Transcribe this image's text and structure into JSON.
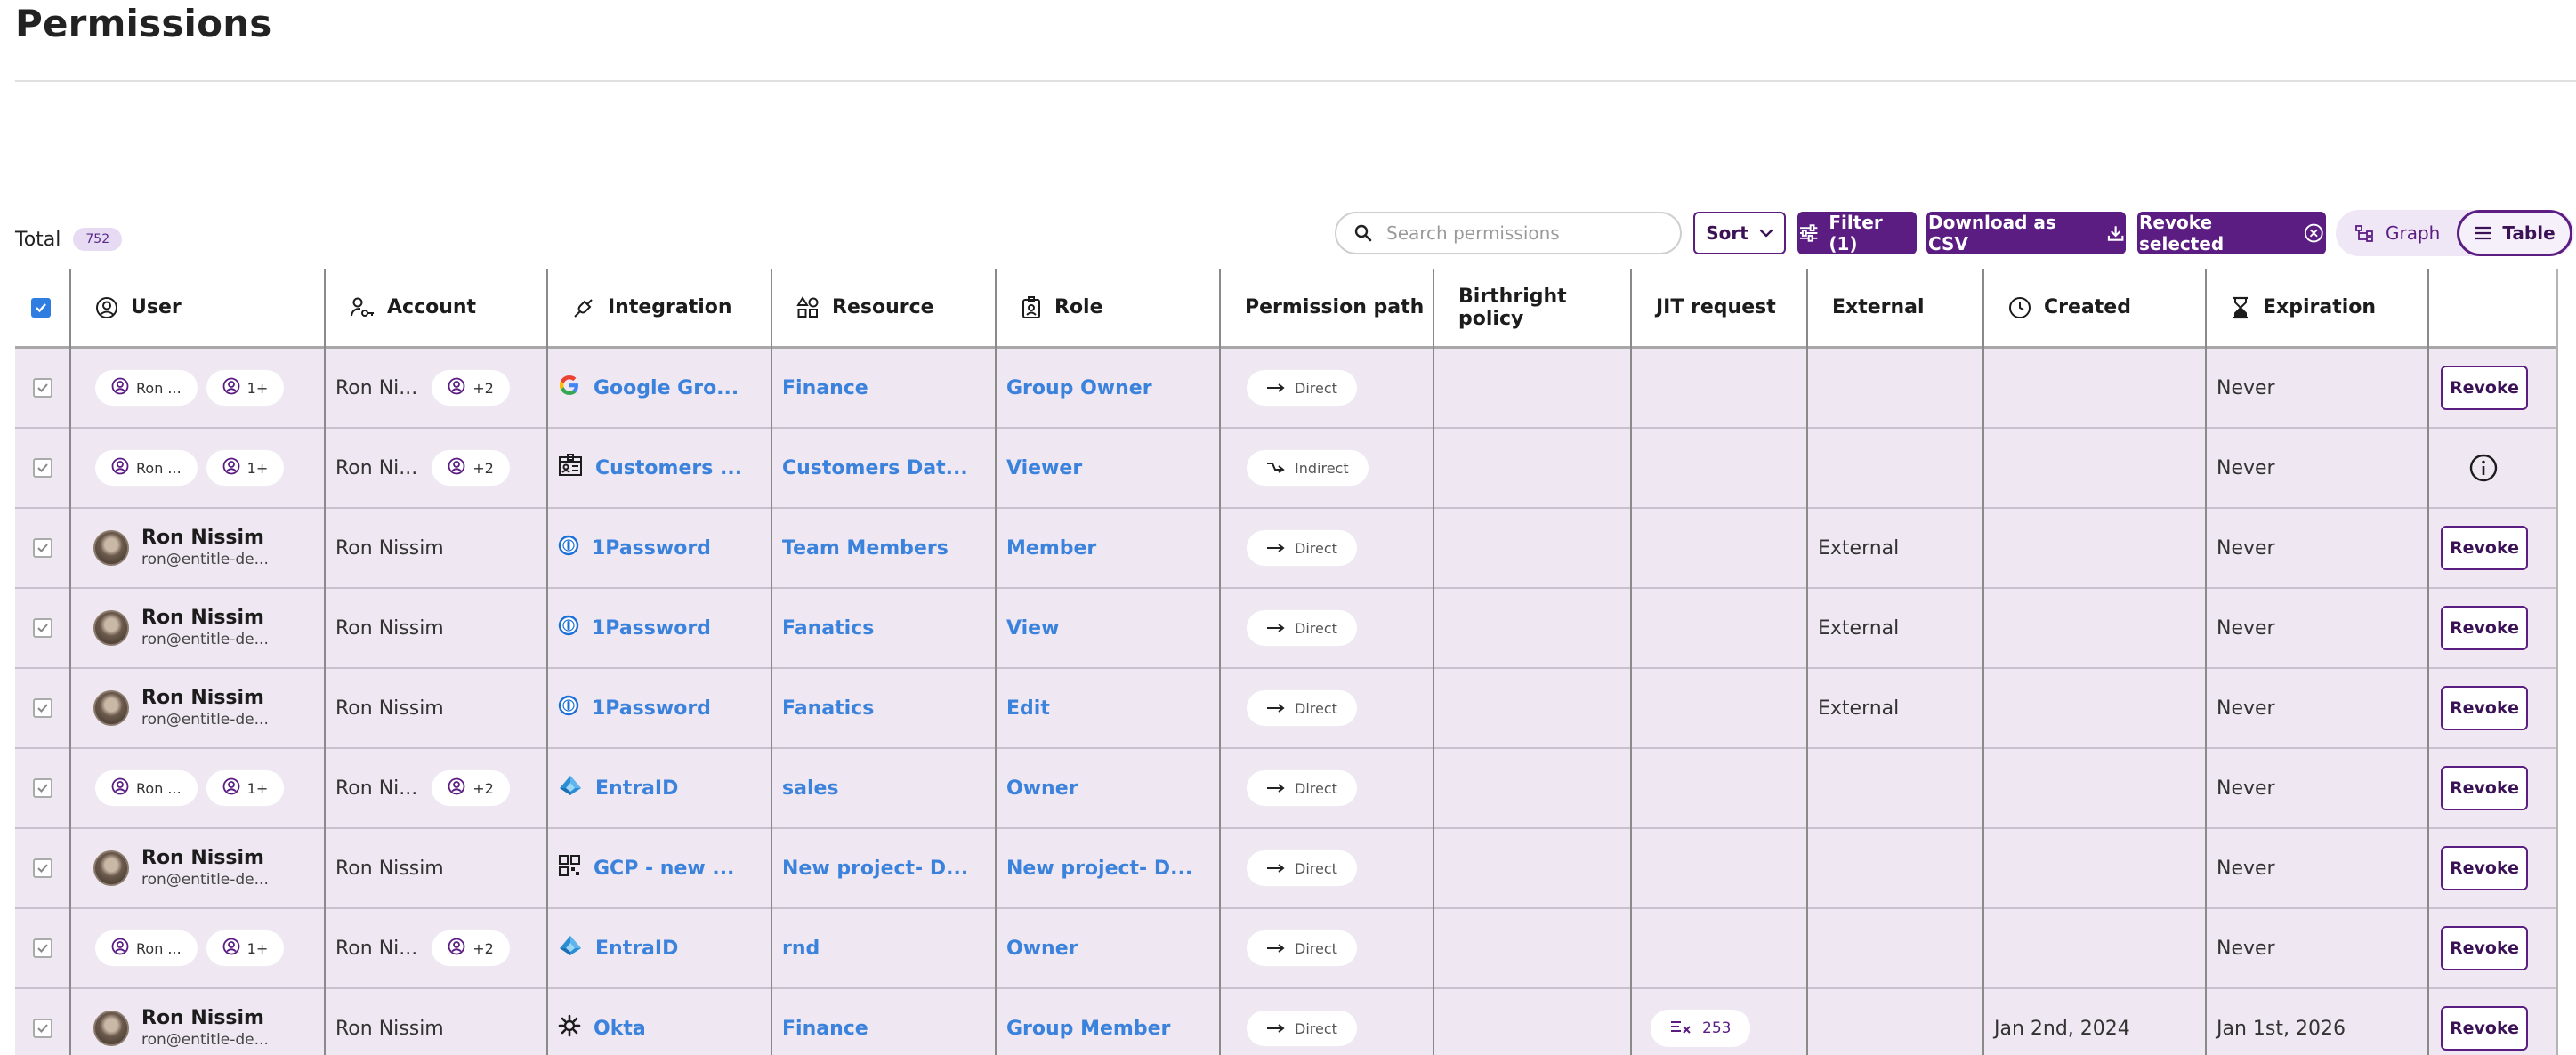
{
  "page": {
    "title": "Permissions"
  },
  "toolbar": {
    "total_label": "Total",
    "total_count": "752",
    "search_placeholder": "Search permissions",
    "sort_label": "Sort",
    "filter_label": "Filter (1)",
    "download_label": "Download as CSV",
    "revoke_selected_label": "Revoke selected",
    "view_graph_label": "Graph",
    "view_table_label": "Table",
    "active_view": "Table"
  },
  "columns": {
    "user": "User",
    "account": "Account",
    "integration": "Integration",
    "resource": "Resource",
    "role": "Role",
    "permission_path": "Permission path",
    "birthright_policy": "Birthright policy",
    "jit_request": "JIT request",
    "external": "External",
    "created": "Created",
    "expiration": "Expiration"
  },
  "rows": [
    {
      "selected": true,
      "user_type": "group",
      "user_chip": "Ron ...",
      "user_extra": "1+",
      "account": "Ron Ni...",
      "account_extra": "+2",
      "integration_icon": "google-icon",
      "integration": "Google Gro...",
      "resource": "Finance",
      "role": "Group Owner",
      "path": "Direct",
      "birthright": "",
      "jit": "",
      "external": "",
      "created": "",
      "expiration": "Never",
      "action": "revoke",
      "action_label": "Revoke"
    },
    {
      "selected": true,
      "user_type": "group",
      "user_chip": "Ron ...",
      "user_extra": "1+",
      "account": "Ron Ni...",
      "account_extra": "+2",
      "integration_icon": "customers-db-icon",
      "integration": "Customers ...",
      "resource": "Customers Dat...",
      "role": "Viewer",
      "path": "Indirect",
      "birthright": "",
      "jit": "",
      "external": "",
      "created": "",
      "expiration": "Never",
      "action": "info",
      "action_label": ""
    },
    {
      "selected": true,
      "user_type": "person",
      "user_name": "Ron Nissim",
      "user_email": "ron@entitle-de...",
      "account": "Ron Nissim",
      "integration_icon": "1password-icon",
      "integration": "1Password",
      "resource": "Team Members",
      "role": "Member",
      "path": "Direct",
      "birthright": "",
      "jit": "",
      "external": "External",
      "created": "",
      "expiration": "Never",
      "action": "revoke",
      "action_label": "Revoke"
    },
    {
      "selected": true,
      "user_type": "person",
      "user_name": "Ron Nissim",
      "user_email": "ron@entitle-de...",
      "account": "Ron Nissim",
      "integration_icon": "1password-icon",
      "integration": "1Password",
      "resource": "Fanatics",
      "role": "View",
      "path": "Direct",
      "birthright": "",
      "jit": "",
      "external": "External",
      "created": "",
      "expiration": "Never",
      "action": "revoke",
      "action_label": "Revoke"
    },
    {
      "selected": true,
      "user_type": "person",
      "user_name": "Ron Nissim",
      "user_email": "ron@entitle-de...",
      "account": "Ron Nissim",
      "integration_icon": "1password-icon",
      "integration": "1Password",
      "resource": "Fanatics",
      "role": "Edit",
      "path": "Direct",
      "birthright": "",
      "jit": "",
      "external": "External",
      "created": "",
      "expiration": "Never",
      "action": "revoke",
      "action_label": "Revoke"
    },
    {
      "selected": true,
      "user_type": "group",
      "user_chip": "Ron ...",
      "user_extra": "1+",
      "account": "Ron Ni...",
      "account_extra": "+2",
      "integration_icon": "entraid-icon",
      "integration": "EntraID",
      "resource": "sales",
      "role": "Owner",
      "path": "Direct",
      "birthright": "",
      "jit": "",
      "external": "",
      "created": "",
      "expiration": "Never",
      "action": "revoke",
      "action_label": "Revoke"
    },
    {
      "selected": true,
      "user_type": "person",
      "user_name": "Ron Nissim",
      "user_email": "ron@entitle-de...",
      "account": "Ron Nissim",
      "integration_icon": "gcp-icon",
      "integration": "GCP - new ...",
      "resource": "New project- D...",
      "role": "New project- D...",
      "path": "Direct",
      "birthright": "",
      "jit": "",
      "external": "",
      "created": "",
      "expiration": "Never",
      "action": "revoke",
      "action_label": "Revoke"
    },
    {
      "selected": true,
      "user_type": "group",
      "user_chip": "Ron ...",
      "user_extra": "1+",
      "account": "Ron Ni...",
      "account_extra": "+2",
      "integration_icon": "entraid-icon",
      "integration": "EntraID",
      "resource": "rnd",
      "role": "Owner",
      "path": "Direct",
      "birthright": "",
      "jit": "",
      "external": "",
      "created": "",
      "expiration": "Never",
      "action": "revoke",
      "action_label": "Revoke"
    },
    {
      "selected": true,
      "user_type": "person",
      "user_name": "Ron Nissim",
      "user_email": "ron@entitle-de...",
      "account": "Ron Nissim",
      "integration_icon": "okta-icon",
      "integration": "Okta",
      "resource": "Finance",
      "role": "Group Member",
      "path": "Direct",
      "birthright": "",
      "jit": "253",
      "external": "",
      "created": "Jan 2nd, 2024",
      "expiration": "Jan 1st, 2026",
      "action": "revoke",
      "action_label": "Revoke"
    }
  ]
}
